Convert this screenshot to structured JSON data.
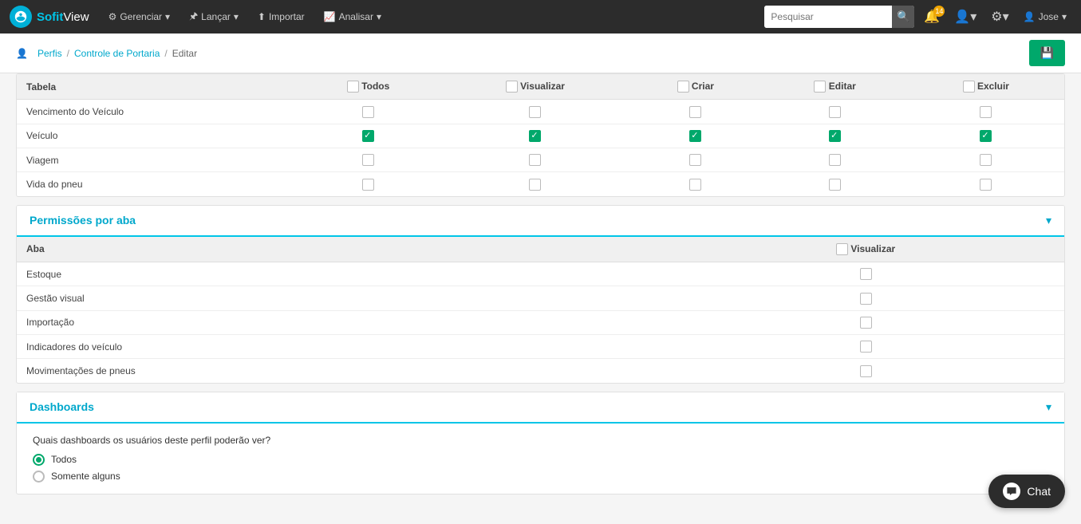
{
  "brand": {
    "name_part1": "Sofit",
    "name_part2": "View"
  },
  "navbar": {
    "items": [
      {
        "label": "Gerenciar",
        "icon": "⚙"
      },
      {
        "label": "Lançar",
        "icon": "📌"
      },
      {
        "label": "Importar",
        "icon": "📥"
      },
      {
        "label": "Analisar",
        "icon": "📈"
      }
    ],
    "search_placeholder": "Pesquisar",
    "notifications_badge": "14",
    "user_name": "Jose"
  },
  "breadcrumb": {
    "items": [
      "Perfis",
      "Controle de Portaria"
    ],
    "current": "Editar"
  },
  "table_permissions": {
    "columns": [
      "Tabela",
      "Todos",
      "Visualizar",
      "Criar",
      "Editar",
      "Excluir"
    ],
    "rows": [
      {
        "name": "Vencimento do Veículo",
        "todos": false,
        "visualizar": false,
        "criar": false,
        "editar": false,
        "excluir": false
      },
      {
        "name": "Veículo",
        "todos": true,
        "visualizar": true,
        "criar": true,
        "editar": true,
        "excluir": true
      },
      {
        "name": "Viagem",
        "todos": false,
        "visualizar": false,
        "criar": false,
        "editar": false,
        "excluir": false
      },
      {
        "name": "Vida do pneu",
        "todos": false,
        "visualizar": false,
        "criar": false,
        "editar": false,
        "excluir": false
      }
    ]
  },
  "permissions_by_tab": {
    "title": "Permissões por aba",
    "columns": [
      "Aba",
      "Visualizar"
    ],
    "rows": [
      {
        "name": "Estoque",
        "visualizar": false
      },
      {
        "name": "Gestão visual",
        "visualizar": false
      },
      {
        "name": "Importação",
        "visualizar": false
      },
      {
        "name": "Indicadores do veículo",
        "visualizar": false
      },
      {
        "name": "Movimentações de pneus",
        "visualizar": false
      }
    ]
  },
  "dashboards": {
    "title": "Dashboards",
    "question": "Quais dashboards os usuários deste perfil poderão ver?",
    "options": [
      {
        "label": "Todos",
        "selected": true
      },
      {
        "label": "Somente alguns",
        "selected": false
      }
    ]
  },
  "chat": {
    "label": "Chat"
  }
}
